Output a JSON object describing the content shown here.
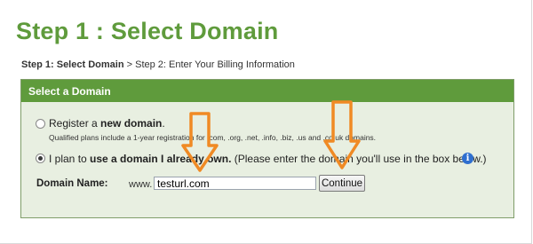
{
  "page": {
    "title": "Step 1 : Select Domain",
    "breadcrumb": {
      "current": "Step 1: Select Domain",
      "separator": ">",
      "next": "Step 2: Enter Your Billing Information"
    }
  },
  "panel": {
    "header": "Select a Domain",
    "options": [
      {
        "id": "register",
        "selected": false,
        "label_prefix": "Register a ",
        "label_bold": "new domain",
        "label_suffix": ".",
        "note": "Qualified plans include a 1-year registration for .com, .org, .net, .info, .biz, .us and .co.uk domains."
      },
      {
        "id": "existing",
        "selected": true,
        "label_prefix": "I plan to ",
        "label_bold": "use a domain I already own.",
        "label_suffix": " (Please enter the domain you'll use in the box below.)"
      }
    ],
    "domain_field": {
      "label": "Domain Name:",
      "prefix": "www.",
      "value": "testurl.com"
    },
    "continue_label": "Continue"
  },
  "colors": {
    "title_green": "#5f9b3c",
    "panel_bg": "#e8efe1",
    "arrow_orange": "#f08a24",
    "info_blue": "#2f6fcf"
  },
  "icons": [
    "info-icon",
    "down-arrow-icon"
  ]
}
